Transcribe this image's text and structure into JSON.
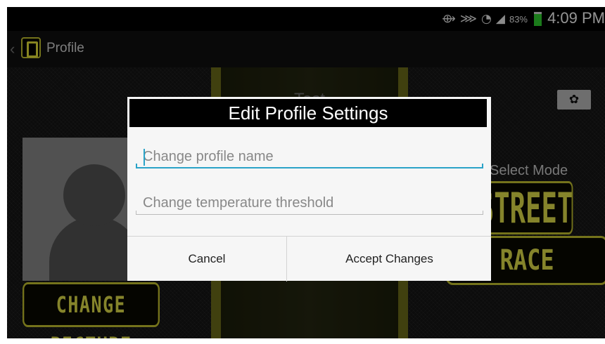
{
  "statusbar": {
    "icons": [
      "nfc-icon",
      "vibrate-icon",
      "wifi-icon",
      "signal-icon"
    ],
    "battery_percent": "83%",
    "battery_level": 0.83,
    "time": "4:09 PM"
  },
  "actionbar": {
    "title": "Profile"
  },
  "background": {
    "profile_name": "Test",
    "change_picture_label": "CHANGE PICTURE",
    "select_mode_label": "Select Mode",
    "street_label": "STREET",
    "race_label": "RACE"
  },
  "dialog": {
    "title": "Edit Profile Settings",
    "name_placeholder": "Change profile name",
    "temperature_placeholder": "Change temperature threshold",
    "cancel_label": "Cancel",
    "accept_label": "Accept Changes"
  },
  "colors": {
    "accent_yellow": "#e6e34a",
    "focus_blue": "#2aa3c8",
    "battery_green": "#2fd42f"
  }
}
